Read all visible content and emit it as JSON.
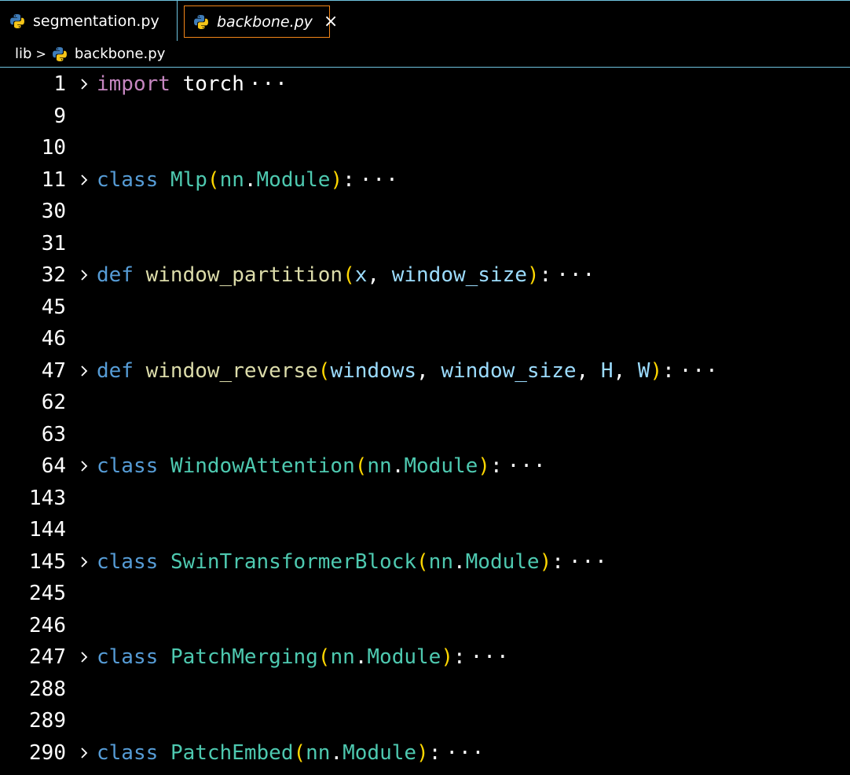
{
  "tabs": [
    {
      "label": "segmentation.py",
      "active": false
    },
    {
      "label": "backbone.py",
      "active": true,
      "close_icon": "×"
    }
  ],
  "breadcrumb": {
    "folder": "lib",
    "separator": ">",
    "file": "backbone.py"
  },
  "colors": {
    "keyword_import": "#c586c0",
    "keyword": "#569cd6",
    "class_name": "#4ec9b0",
    "function_name": "#dcdcaa",
    "parameter": "#9cdcfe",
    "bracket": "#ffd700",
    "border_accent": "#6fc3df",
    "active_tab_border": "#f38518"
  },
  "icons": {
    "python_file": "python-icon",
    "fold_chevron": "chevron-right-icon"
  },
  "lines": [
    {
      "n": "1",
      "fold": true,
      "tokens": [
        {
          "t": "import",
          "c": "kw-import"
        },
        {
          "t": " torch",
          "c": "plain"
        }
      ],
      "collapsed": "···"
    },
    {
      "n": "9",
      "fold": false,
      "tokens": []
    },
    {
      "n": "10",
      "fold": false,
      "tokens": []
    },
    {
      "n": "11",
      "fold": true,
      "tokens": [
        {
          "t": "class",
          "c": "kw"
        },
        {
          "t": " ",
          "c": "plain"
        },
        {
          "t": "Mlp",
          "c": "cls"
        },
        {
          "t": "(",
          "c": "paren"
        },
        {
          "t": "nn",
          "c": "cls"
        },
        {
          "t": ".",
          "c": "plain"
        },
        {
          "t": "Module",
          "c": "cls"
        },
        {
          "t": ")",
          "c": "paren"
        },
        {
          "t": ":",
          "c": "plain"
        }
      ],
      "collapsed": "···"
    },
    {
      "n": "30",
      "fold": false,
      "tokens": []
    },
    {
      "n": "31",
      "fold": false,
      "tokens": []
    },
    {
      "n": "32",
      "fold": true,
      "tokens": [
        {
          "t": "def",
          "c": "kw"
        },
        {
          "t": " ",
          "c": "plain"
        },
        {
          "t": "window_partition",
          "c": "fn"
        },
        {
          "t": "(",
          "c": "paren"
        },
        {
          "t": "x",
          "c": "param"
        },
        {
          "t": ", ",
          "c": "plain"
        },
        {
          "t": "window_size",
          "c": "param"
        },
        {
          "t": ")",
          "c": "paren"
        },
        {
          "t": ":",
          "c": "plain"
        }
      ],
      "collapsed": "···"
    },
    {
      "n": "45",
      "fold": false,
      "tokens": []
    },
    {
      "n": "46",
      "fold": false,
      "tokens": []
    },
    {
      "n": "47",
      "fold": true,
      "tokens": [
        {
          "t": "def",
          "c": "kw"
        },
        {
          "t": " ",
          "c": "plain"
        },
        {
          "t": "window_reverse",
          "c": "fn"
        },
        {
          "t": "(",
          "c": "paren"
        },
        {
          "t": "windows",
          "c": "param"
        },
        {
          "t": ", ",
          "c": "plain"
        },
        {
          "t": "window_size",
          "c": "param"
        },
        {
          "t": ", ",
          "c": "plain"
        },
        {
          "t": "H",
          "c": "param"
        },
        {
          "t": ", ",
          "c": "plain"
        },
        {
          "t": "W",
          "c": "param"
        },
        {
          "t": ")",
          "c": "paren"
        },
        {
          "t": ":",
          "c": "plain"
        }
      ],
      "collapsed": "···"
    },
    {
      "n": "62",
      "fold": false,
      "tokens": []
    },
    {
      "n": "63",
      "fold": false,
      "tokens": []
    },
    {
      "n": "64",
      "fold": true,
      "tokens": [
        {
          "t": "class",
          "c": "kw"
        },
        {
          "t": " ",
          "c": "plain"
        },
        {
          "t": "WindowAttention",
          "c": "cls"
        },
        {
          "t": "(",
          "c": "paren"
        },
        {
          "t": "nn",
          "c": "cls"
        },
        {
          "t": ".",
          "c": "plain"
        },
        {
          "t": "Module",
          "c": "cls"
        },
        {
          "t": ")",
          "c": "paren"
        },
        {
          "t": ":",
          "c": "plain"
        }
      ],
      "collapsed": "···"
    },
    {
      "n": "143",
      "fold": false,
      "tokens": []
    },
    {
      "n": "144",
      "fold": false,
      "tokens": []
    },
    {
      "n": "145",
      "fold": true,
      "tokens": [
        {
          "t": "class",
          "c": "kw"
        },
        {
          "t": " ",
          "c": "plain"
        },
        {
          "t": "SwinTransformerBlock",
          "c": "cls"
        },
        {
          "t": "(",
          "c": "paren"
        },
        {
          "t": "nn",
          "c": "cls"
        },
        {
          "t": ".",
          "c": "plain"
        },
        {
          "t": "Module",
          "c": "cls"
        },
        {
          "t": ")",
          "c": "paren"
        },
        {
          "t": ":",
          "c": "plain"
        }
      ],
      "collapsed": "···"
    },
    {
      "n": "245",
      "fold": false,
      "tokens": []
    },
    {
      "n": "246",
      "fold": false,
      "tokens": []
    },
    {
      "n": "247",
      "fold": true,
      "tokens": [
        {
          "t": "class",
          "c": "kw"
        },
        {
          "t": " ",
          "c": "plain"
        },
        {
          "t": "PatchMerging",
          "c": "cls"
        },
        {
          "t": "(",
          "c": "paren"
        },
        {
          "t": "nn",
          "c": "cls"
        },
        {
          "t": ".",
          "c": "plain"
        },
        {
          "t": "Module",
          "c": "cls"
        },
        {
          "t": ")",
          "c": "paren"
        },
        {
          "t": ":",
          "c": "plain"
        }
      ],
      "collapsed": "···"
    },
    {
      "n": "288",
      "fold": false,
      "tokens": []
    },
    {
      "n": "289",
      "fold": false,
      "tokens": []
    },
    {
      "n": "290",
      "fold": true,
      "tokens": [
        {
          "t": "class",
          "c": "kw"
        },
        {
          "t": " ",
          "c": "plain"
        },
        {
          "t": "PatchEmbed",
          "c": "cls"
        },
        {
          "t": "(",
          "c": "paren"
        },
        {
          "t": "nn",
          "c": "cls"
        },
        {
          "t": ".",
          "c": "plain"
        },
        {
          "t": "Module",
          "c": "cls"
        },
        {
          "t": ")",
          "c": "paren"
        },
        {
          "t": ":",
          "c": "plain"
        }
      ],
      "collapsed": "···"
    }
  ]
}
